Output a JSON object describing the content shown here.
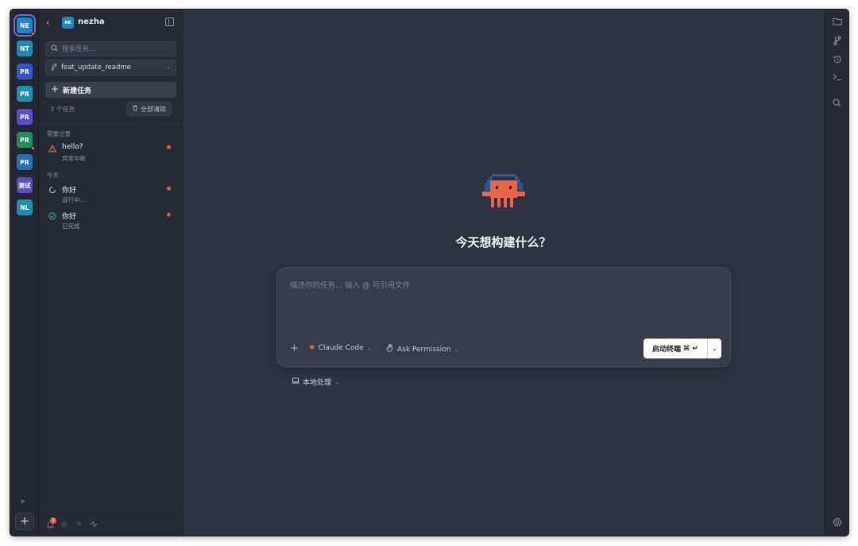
{
  "colors": {
    "accent": "#6c6fd8",
    "agent": "#e0703f",
    "warning": "#e8774a",
    "success": "#3fb98a"
  },
  "projects": [
    {
      "label": "NE",
      "color": "#1b87c9",
      "active": true,
      "dot": true
    },
    {
      "label": "NT",
      "color": "#1b8fb0",
      "active": false,
      "dot": false
    },
    {
      "label": "PR",
      "color": "#3556c6",
      "active": false,
      "dot": false
    },
    {
      "label": "PR",
      "color": "#1e8fb3",
      "active": false,
      "dot": false
    },
    {
      "label": "PR",
      "color": "#5a4fc6",
      "active": false,
      "dot": false
    },
    {
      "label": "PR",
      "color": "#1f8f57",
      "active": false,
      "dot": true
    },
    {
      "label": "PR",
      "color": "#2172b8",
      "active": false,
      "dot": false
    },
    {
      "label": "测试",
      "color": "#5b4ec2",
      "active": false,
      "dot": false
    },
    {
      "label": "NL",
      "color": "#1e8db1",
      "active": false,
      "dot": false
    }
  ],
  "sidebar": {
    "project_logo": "NE",
    "project_name": "nezha",
    "search_placeholder": "搜索任务...",
    "branch": "feat_update_readme",
    "new_task": "新建任务",
    "task_count": "3 个任务",
    "clear_all": "全部清除",
    "groups": [
      {
        "label": "需要注意",
        "tasks": [
          {
            "title": "hello?",
            "status": "异常中断",
            "icon": "warning-icon"
          }
        ]
      },
      {
        "label": "今天",
        "tasks": [
          {
            "title": "你好",
            "status": "运行中...",
            "icon": "spinner-icon"
          },
          {
            "title": "你好",
            "status": "已完成",
            "icon": "check-circle-icon"
          }
        ]
      }
    ],
    "notification_count": "1"
  },
  "main": {
    "headline": "今天想构建什么？",
    "composer_placeholder": "描述你的任务... 输入 @ 可引用文件",
    "agent": "Claude Code",
    "permission": "Ask Permission",
    "launch": "启动终端",
    "launch_shortcut": "⌘ ↵",
    "mode": "本地处理"
  }
}
